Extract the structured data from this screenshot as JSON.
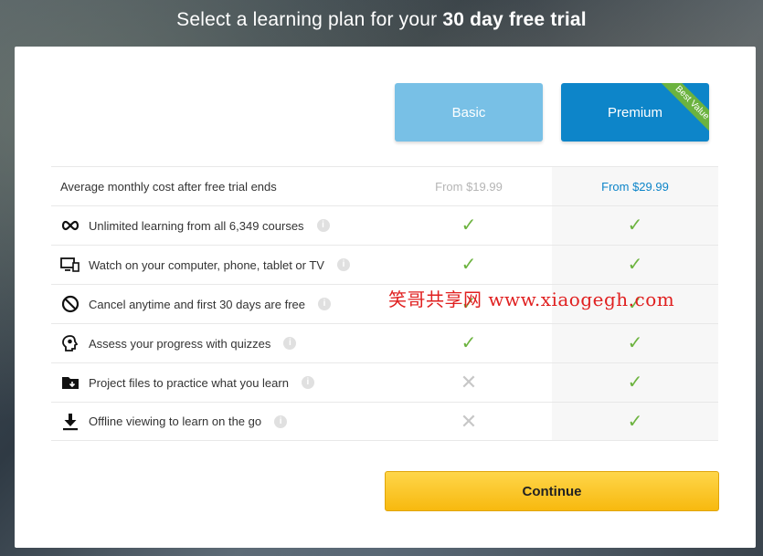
{
  "headline": {
    "prefix": "Select a learning plan for your ",
    "bold": "30 day free trial"
  },
  "plans": {
    "basic": "Basic",
    "premium": "Premium",
    "badge": "Best Value"
  },
  "rows": [
    {
      "icon": "dollar-icon",
      "label": "Average monthly cost after free trial ends",
      "basic": "From $19.99",
      "premium": "From $29.99",
      "info": false
    },
    {
      "icon": "infinity-icon",
      "label": "Unlimited learning from all 6,349 courses",
      "basic": "✓",
      "premium": "✓",
      "info": true
    },
    {
      "icon": "devices-icon",
      "label": "Watch on your computer, phone, tablet or TV",
      "basic": "✓",
      "premium": "✓",
      "info": true
    },
    {
      "icon": "cancel-icon",
      "label": "Cancel anytime and first 30 days are free",
      "basic": "✓",
      "premium": "✓",
      "info": true
    },
    {
      "icon": "quiz-head-icon",
      "label": "Assess your progress with quizzes",
      "basic": "✓",
      "premium": "✓",
      "info": true
    },
    {
      "icon": "folder-icon",
      "label": "Project files to practice what you learn",
      "basic": "✕",
      "premium": "✓",
      "info": true
    },
    {
      "icon": "download-icon",
      "label": "Offline viewing to learn on the go",
      "basic": "✕",
      "premium": "✓",
      "info": true
    }
  ],
  "continue_label": "Continue",
  "info_glyph": "i",
  "watermark": "笑哥共享网 www.xiaogegh.com",
  "colors": {
    "accent": "#0d85c9",
    "basic": "#78c0e6",
    "check": "#6cb33f",
    "button": "#f7b90f"
  }
}
